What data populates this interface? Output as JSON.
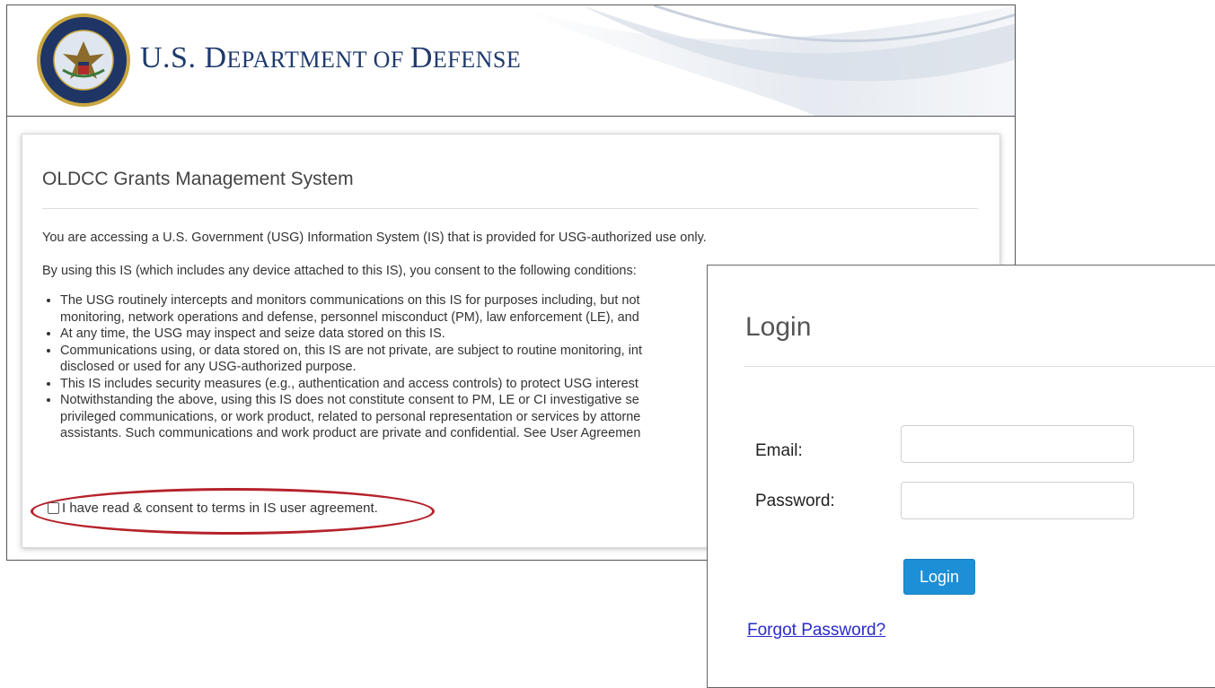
{
  "header": {
    "seal_text": "DEPARTMENT OF DEFENSE · UNITED STATES OF AMERICA",
    "dept_title": {
      "part1": "U.S. D",
      "part2": "EPARTMENT OF ",
      "part3": "D",
      "part4": "EFENSE"
    }
  },
  "notice": {
    "title": "OLDCC Grants Management System",
    "intro": "You are accessing a U.S. Government (USG) Information System (IS) that is provided for USG-authorized use only.",
    "consent_intro": "By using this IS (which includes any device attached to this IS), you consent to the following conditions:",
    "conditions": [
      {
        "line1": "The USG routinely intercepts and monitors communications on this IS for purposes including, but not",
        "line2": "monitoring, network operations and defense, personnel misconduct (PM), law enforcement (LE), and"
      },
      {
        "line1": "At any time, the USG may inspect and seize data stored on this IS.",
        "line2": ""
      },
      {
        "line1": "Communications using, or data stored on, this IS are not private, are subject to routine monitoring, int",
        "line2": "disclosed or used for any USG-authorized purpose."
      },
      {
        "line1": "This IS includes security measures (e.g., authentication and access controls) to protect USG interest",
        "line2": ""
      },
      {
        "line1": "Notwithstanding the above, using this IS does not constitute consent to PM, LE or CI investigative se",
        "line2": "privileged communications, or work product, related to personal representation or services by attorne",
        "line3": "assistants. Such communications and work product are private and confidential. See User Agreemen"
      }
    ],
    "consent_label": "I have read & consent to terms in IS user agreement.",
    "consent_checked": false
  },
  "annotation": {
    "color": "#b5222c"
  },
  "login": {
    "title": "Login",
    "email_label": "Email:",
    "email_value": "",
    "password_label": "Password:",
    "password_value": "",
    "button_label": "Login",
    "forgot_link": "Forgot Password?",
    "accent_color": "#1d8fd6"
  }
}
